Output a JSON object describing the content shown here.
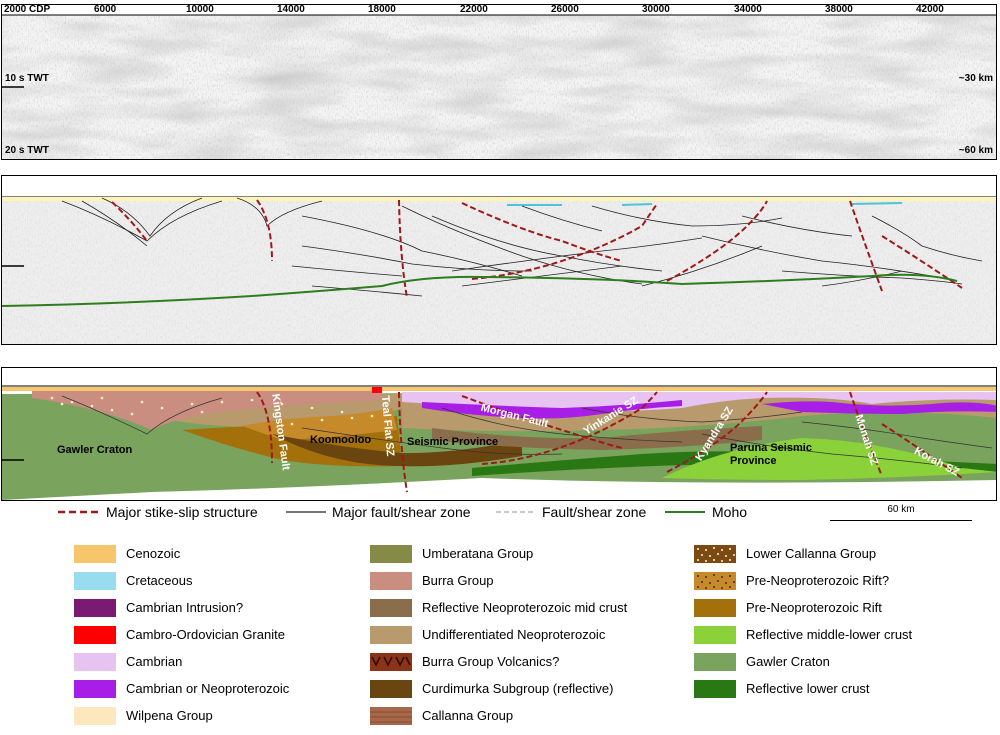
{
  "seismic_panel": {
    "cdp_ticks": [
      "2000 CDP",
      "6000",
      "10000",
      "14000",
      "18000",
      "22000",
      "26000",
      "30000",
      "34000",
      "38000",
      "42000"
    ],
    "left_labels": [
      "10 s TWT",
      "20 s TWT"
    ],
    "right_labels": [
      "~30 km",
      "~60 km"
    ]
  },
  "section_labels": {
    "gawler": "Gawler Craton",
    "kingston": "Kingston Fault",
    "koomooloo": "Koomooloo",
    "teal_flat": "Teal Flat SZ",
    "seismic_province": "Seismic Province",
    "morgan": "Morgan Fault",
    "yinkanie": "Yinkanie SZ",
    "kyandra": "Kyandra SZ",
    "paruna": "Paruna Seismic Province",
    "monah": "Monah SZ",
    "korah": "Korah SZ"
  },
  "structure_legend": [
    {
      "label": "Major stike-slip structure",
      "style": "dashed",
      "color": "#a01818"
    },
    {
      "label": "Major fault/shear zone",
      "style": "solid",
      "color": "#222222"
    },
    {
      "label": "Fault/shear zone",
      "style": "dashed",
      "color": "#aaaaaa"
    },
    {
      "label": "Moho",
      "style": "solid",
      "color": "#2e7d1e"
    }
  ],
  "scale_bar": {
    "label": "60 km"
  },
  "unit_legend": {
    "col1": [
      {
        "label": "Cenozoic",
        "color": "#f7c56b"
      },
      {
        "label": "Cretaceous",
        "color": "#9adcef"
      },
      {
        "label": "Cambrian Intrusion?",
        "color": "#7a1a73"
      },
      {
        "label": "Cambro-Ordovician Granite",
        "color": "#ff0000"
      },
      {
        "label": "Cambrian",
        "color": "#e7c3f2"
      },
      {
        "label": "Cambrian or Neoproterozoic",
        "color": "#a71ee6"
      },
      {
        "label": "Wilpena Group",
        "color": "#fde8bd"
      }
    ],
    "col2": [
      {
        "label": "Umberatana Group",
        "color": "#858a47"
      },
      {
        "label": "Burra Group",
        "color": "#c98e80"
      },
      {
        "label": "Reflective Neoproterozoic mid crust",
        "color": "#8a6d4a"
      },
      {
        "label": "Undifferentiated Neoproterozoic",
        "color": "#b99a6c"
      },
      {
        "label": "Burra Group Volcanics?",
        "color": "#8c3418"
      },
      {
        "label": "Curdimurka Subgroup (reflective)",
        "color": "#6b4510"
      },
      {
        "label": "Callanna Group",
        "color": "#a66848"
      }
    ],
    "col3": [
      {
        "label": "Lower Callanna Group",
        "color": "#7a4a12"
      },
      {
        "label": "Pre-Neoproterozoic Rift?",
        "color": "#c68a2a"
      },
      {
        "label": "Pre-Neoproterozoic Rift",
        "color": "#a4700c"
      },
      {
        "label": "Reflective middle-lower crust",
        "color": "#8bd13a"
      },
      {
        "label": "Gawler Craton",
        "color": "#7aa35e"
      },
      {
        "label": "Reflective lower crust",
        "color": "#2a7814"
      }
    ]
  }
}
